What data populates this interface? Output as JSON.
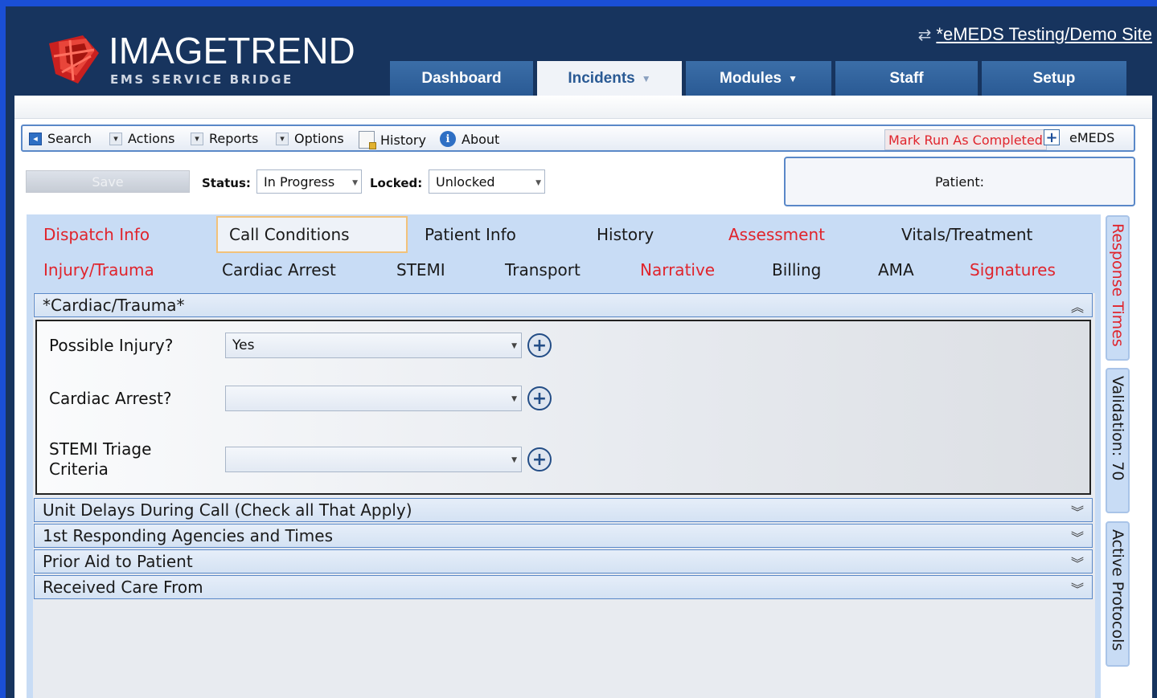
{
  "brand": {
    "name": "IMAGETREND",
    "subtitle": "EMS SERVICE BRIDGE"
  },
  "site_link": "*eMEDS Testing/Demo Site",
  "topnav": [
    {
      "label": "Dashboard",
      "active": false
    },
    {
      "label": "Incidents",
      "active": true
    },
    {
      "label": "Modules",
      "active": false
    },
    {
      "label": "Staff",
      "active": false
    },
    {
      "label": "Setup",
      "active": false
    }
  ],
  "toolbar": {
    "search": "Search",
    "actions": "Actions",
    "reports": "Reports",
    "options": "Options",
    "history": "History",
    "about": "About",
    "mark_run": "Mark Run As Completed",
    "emeds": "eMEDS"
  },
  "form": {
    "save": "Save",
    "status_label": "Status:",
    "status_value": "In Progress",
    "locked_label": "Locked:",
    "locked_value": "Unlocked",
    "patient_label": "Patient:"
  },
  "form_tabs": {
    "row1": [
      "Dispatch Info",
      "Call Conditions",
      "Patient Info",
      "History",
      "Assessment",
      "Vitals/Treatment"
    ],
    "row2": [
      "Injury/Trauma",
      "Cardiac Arrest",
      "STEMI",
      "Transport",
      "Narrative",
      "Billing",
      "AMA",
      "Signatures"
    ],
    "active": "Call Conditions",
    "required_color": "#e0242c"
  },
  "sections": {
    "cardiac_trauma": {
      "title": "*Cardiac/Trauma*",
      "questions": [
        {
          "label": "Possible Injury?",
          "value": "Yes"
        },
        {
          "label": "Cardiac Arrest?",
          "value": ""
        },
        {
          "label_line1": "STEMI Triage",
          "label_line2": "Criteria",
          "value": ""
        }
      ]
    },
    "collapsed": [
      "Unit Delays During Call (Check all That Apply)",
      "1st Responding Agencies and Times",
      "Prior Aid to Patient",
      "Received Care From"
    ]
  },
  "side_tabs": {
    "response_times": "Response Times",
    "validation": "Validation: 70",
    "active_protocols": "Active Protocols"
  }
}
